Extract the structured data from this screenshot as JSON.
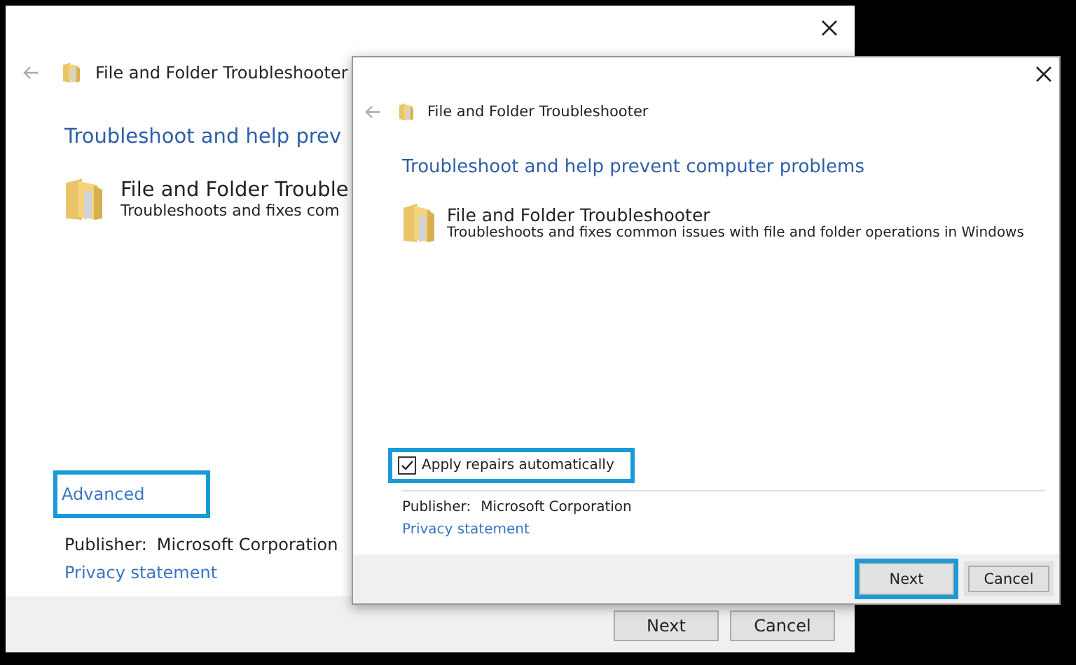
{
  "back_window": {
    "title": "File and Folder Troubleshooter",
    "heading": "Troubleshoot and help prev",
    "item": {
      "title": "File and Folder Trouble",
      "description": "Troubleshoots and fixes com"
    },
    "advanced_link": {
      "label": "Advanced",
      "highlighted": true
    },
    "publisher_label": "Publisher:",
    "publisher": "Microsoft Corporation",
    "privacy_link": "Privacy statement",
    "buttons": [
      {
        "label": "Next",
        "highlighted": false
      },
      {
        "label": "Cancel",
        "highlighted": false
      }
    ]
  },
  "front_window": {
    "title": "File and Folder Troubleshooter",
    "heading": "Troubleshoot and help prevent computer problems",
    "item": {
      "title": "File and Folder Troubleshooter",
      "description": "Troubleshoots and fixes common issues with file and folder operations in Windows"
    },
    "checkbox": {
      "label": "Apply repairs automatically",
      "checked": true,
      "highlighted": true
    },
    "publisher_label": "Publisher:",
    "publisher": "Microsoft Corporation",
    "privacy_link": "Privacy statement",
    "buttons": [
      {
        "label": "Next",
        "highlighted": true
      },
      {
        "label": "Cancel",
        "highlighted": false
      }
    ]
  }
}
